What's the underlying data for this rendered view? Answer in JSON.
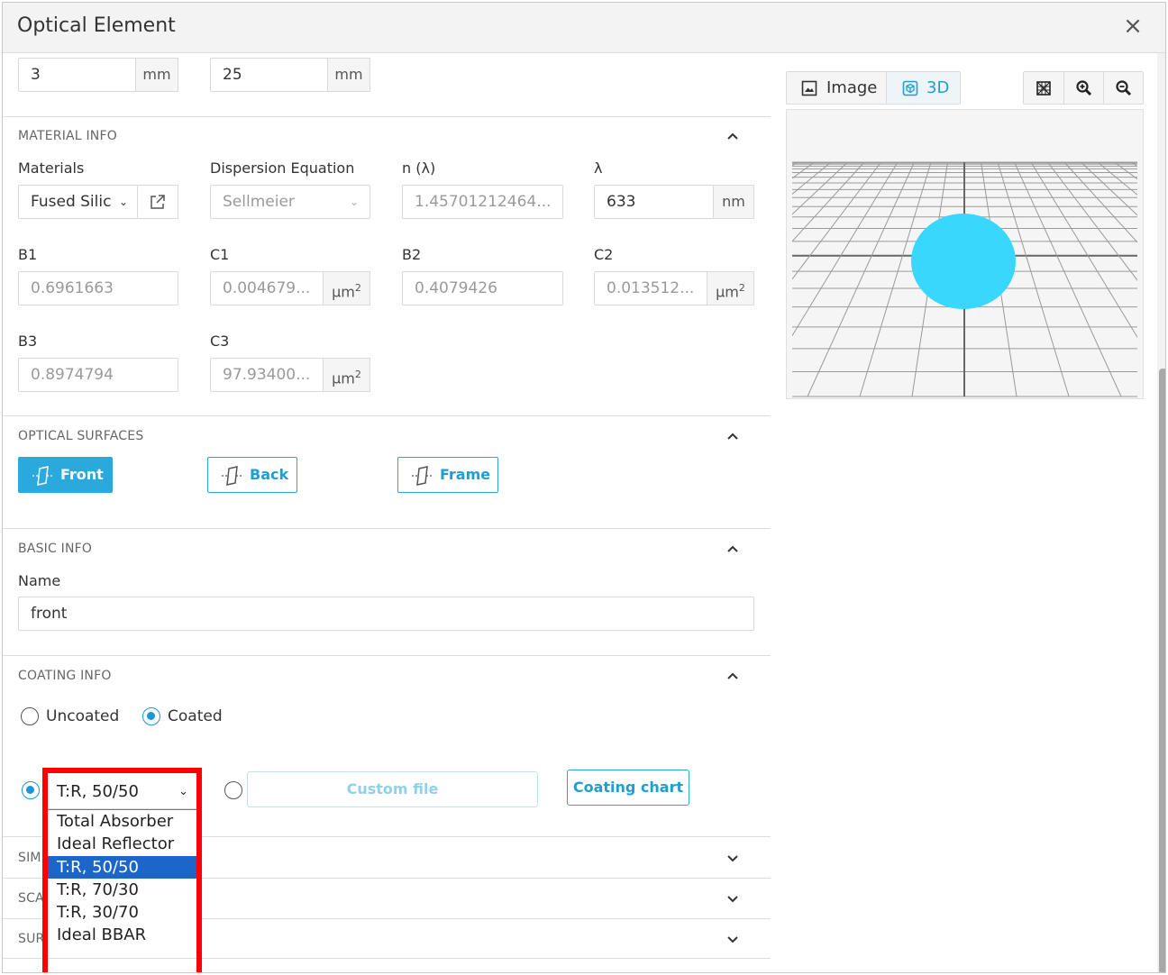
{
  "dialog": {
    "title": "Optical Element",
    "close_icon": "×"
  },
  "dimensions": {
    "field1": {
      "value": "3",
      "unit": "mm"
    },
    "field2": {
      "value": "25",
      "unit": "mm"
    }
  },
  "material_info": {
    "heading": "MATERIAL INFO",
    "materials_label": "Materials",
    "materials_value": "Fused Silic",
    "dispersion_label": "Dispersion Equation",
    "dispersion_value": "Sellmeier",
    "n_label": "n (λ)",
    "n_value": "1.45701212464...",
    "lambda_label": "λ",
    "lambda_value": "633",
    "lambda_unit": "nm",
    "b1_label": "B1",
    "b1_value": "0.6961663",
    "c1_label": "C1",
    "c1_value": "0.004679...",
    "b2_label": "B2",
    "b2_value": "0.4079426",
    "c2_label": "C2",
    "c2_value": "0.013512...",
    "b3_label": "B3",
    "b3_value": "0.8974794",
    "c3_label": "C3",
    "c3_value": "97.93400...",
    "um_unit": "μm",
    "sq": "2"
  },
  "optical_surfaces": {
    "heading": "OPTICAL SURFACES",
    "front": "Front",
    "back": "Back",
    "frame": "Frame"
  },
  "basic_info": {
    "heading": "BASIC INFO",
    "name_label": "Name",
    "name_value": "front"
  },
  "coating_info": {
    "heading": "COATING INFO",
    "uncoated": "Uncoated",
    "coated": "Coated",
    "selected_coating": "T:R, 50/50",
    "options": [
      "Total Absorber",
      "Ideal Reflector",
      "T:R, 50/50",
      "T:R, 70/30",
      "T:R, 30/70",
      "Ideal BBAR"
    ],
    "custom_file": "Custom file",
    "coating_chart": "Coating chart"
  },
  "collapsed_sections": [
    "SIM",
    "SCA",
    "SUR"
  ],
  "viewer": {
    "image_tab": "Image",
    "threed_tab": "3D",
    "accent": "#1f9fd1",
    "sphere_color": "#39d7fb"
  }
}
